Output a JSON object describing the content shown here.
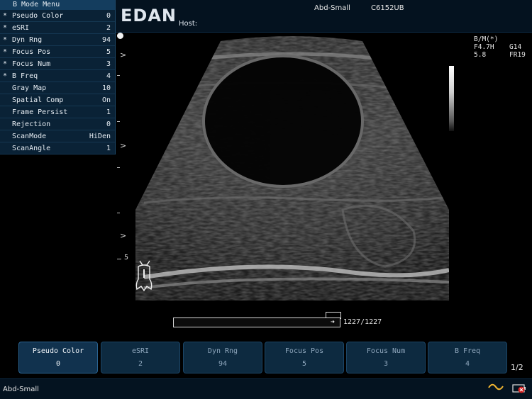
{
  "header": {
    "logo": "EDAN",
    "host_label": "Host:",
    "exam_preset": "Abd-Small",
    "probe_model": "C6152UB"
  },
  "menu": {
    "title": "B Mode Menu",
    "items": [
      {
        "star": "*",
        "label": "Pseudo Color",
        "value": "0"
      },
      {
        "star": "*",
        "label": "eSRI",
        "value": "2"
      },
      {
        "star": "*",
        "label": "Dyn Rng",
        "value": "94"
      },
      {
        "star": "*",
        "label": "Focus Pos",
        "value": "5"
      },
      {
        "star": "*",
        "label": "Focus Num",
        "value": "3"
      },
      {
        "star": "*",
        "label": "B Freq",
        "value": "4"
      },
      {
        "star": "",
        "label": "Gray Map",
        "value": "10"
      },
      {
        "star": "",
        "label": "Spatial Comp",
        "value": "On"
      },
      {
        "star": "",
        "label": "Frame Persist",
        "value": "1"
      },
      {
        "star": "",
        "label": "Rejection",
        "value": "0"
      },
      {
        "star": "",
        "label": "ScanMode",
        "value": "HiDen"
      },
      {
        "star": "",
        "label": "ScanAngle",
        "value": "1"
      }
    ]
  },
  "image": {
    "depth_label": "5",
    "focus_marker": ">",
    "scan_params": [
      [
        "B/M(*)",
        ""
      ],
      [
        "F4.7H",
        "G14"
      ],
      [
        "5.8",
        "FR19"
      ]
    ]
  },
  "cine": {
    "counter": "1227/1227",
    "progress": 1.0
  },
  "softkeys": [
    {
      "label": "Pseudo Color",
      "value": "0",
      "active": true
    },
    {
      "label": "eSRI",
      "value": "2",
      "active": false
    },
    {
      "label": "Dyn Rng",
      "value": "94",
      "active": false
    },
    {
      "label": "Focus Pos",
      "value": "5",
      "active": false
    },
    {
      "label": "Focus Num",
      "value": "3",
      "active": false
    },
    {
      "label": "B Freq",
      "value": "4",
      "active": false
    }
  ],
  "page_indicator": "1/2",
  "status": {
    "preset": "Abd-Small",
    "icons": [
      "wave-icon",
      "battery-icon"
    ]
  },
  "colors": {
    "panel": "#0a2236",
    "accent": "#143d5e",
    "wave": "#f2b632",
    "battery_alert": "#d32020"
  }
}
